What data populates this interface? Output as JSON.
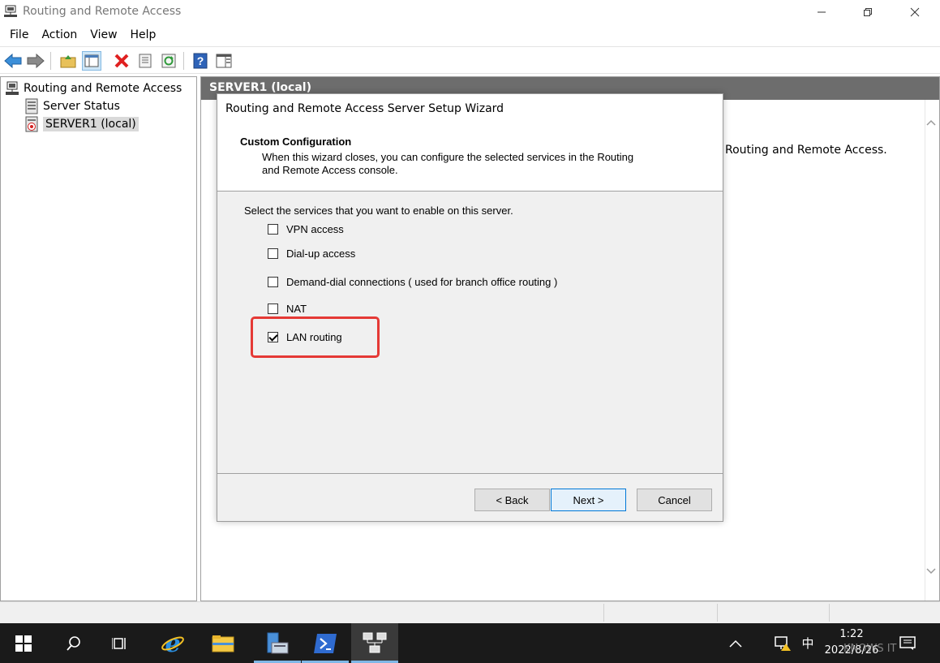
{
  "window": {
    "title": "Routing and Remote Access"
  },
  "menu": {
    "items": [
      "File",
      "Action",
      "View",
      "Help"
    ]
  },
  "tree": {
    "root": "Routing and Remote Access",
    "server_status": "Server Status",
    "server": "SERVER1 (local)"
  },
  "right_pane": {
    "header": "SERVER1 (local)",
    "background_text": "Routing and Remote Access."
  },
  "wizard": {
    "title": "Routing and Remote Access Server Setup Wizard",
    "header_title": "Custom Configuration",
    "header_desc": "When this wizard closes, you can configure the selected services in the Routing and Remote Access console.",
    "prompt": "Select the services that you want to enable on this server.",
    "options": [
      {
        "label": "VPN access",
        "checked": false
      },
      {
        "label": "Dial-up access",
        "checked": false
      },
      {
        "label": "Demand-dial connections ( used for branch office routing )",
        "checked": false
      },
      {
        "label": "NAT",
        "checked": false
      },
      {
        "label": "LAN routing",
        "checked": true
      }
    ],
    "back_label": "< Back",
    "next_label": "Next >",
    "cancel_label": "Cancel",
    "highlight_color": "#e53935"
  },
  "taskbar": {
    "time": "1:22",
    "date": "2022/8/26",
    "ime": "中",
    "watermark": "KNOWS IT"
  },
  "colors": {
    "accent": "#0078d7",
    "taskbar": "#1a1a1a",
    "header": "#6d6d6d"
  }
}
